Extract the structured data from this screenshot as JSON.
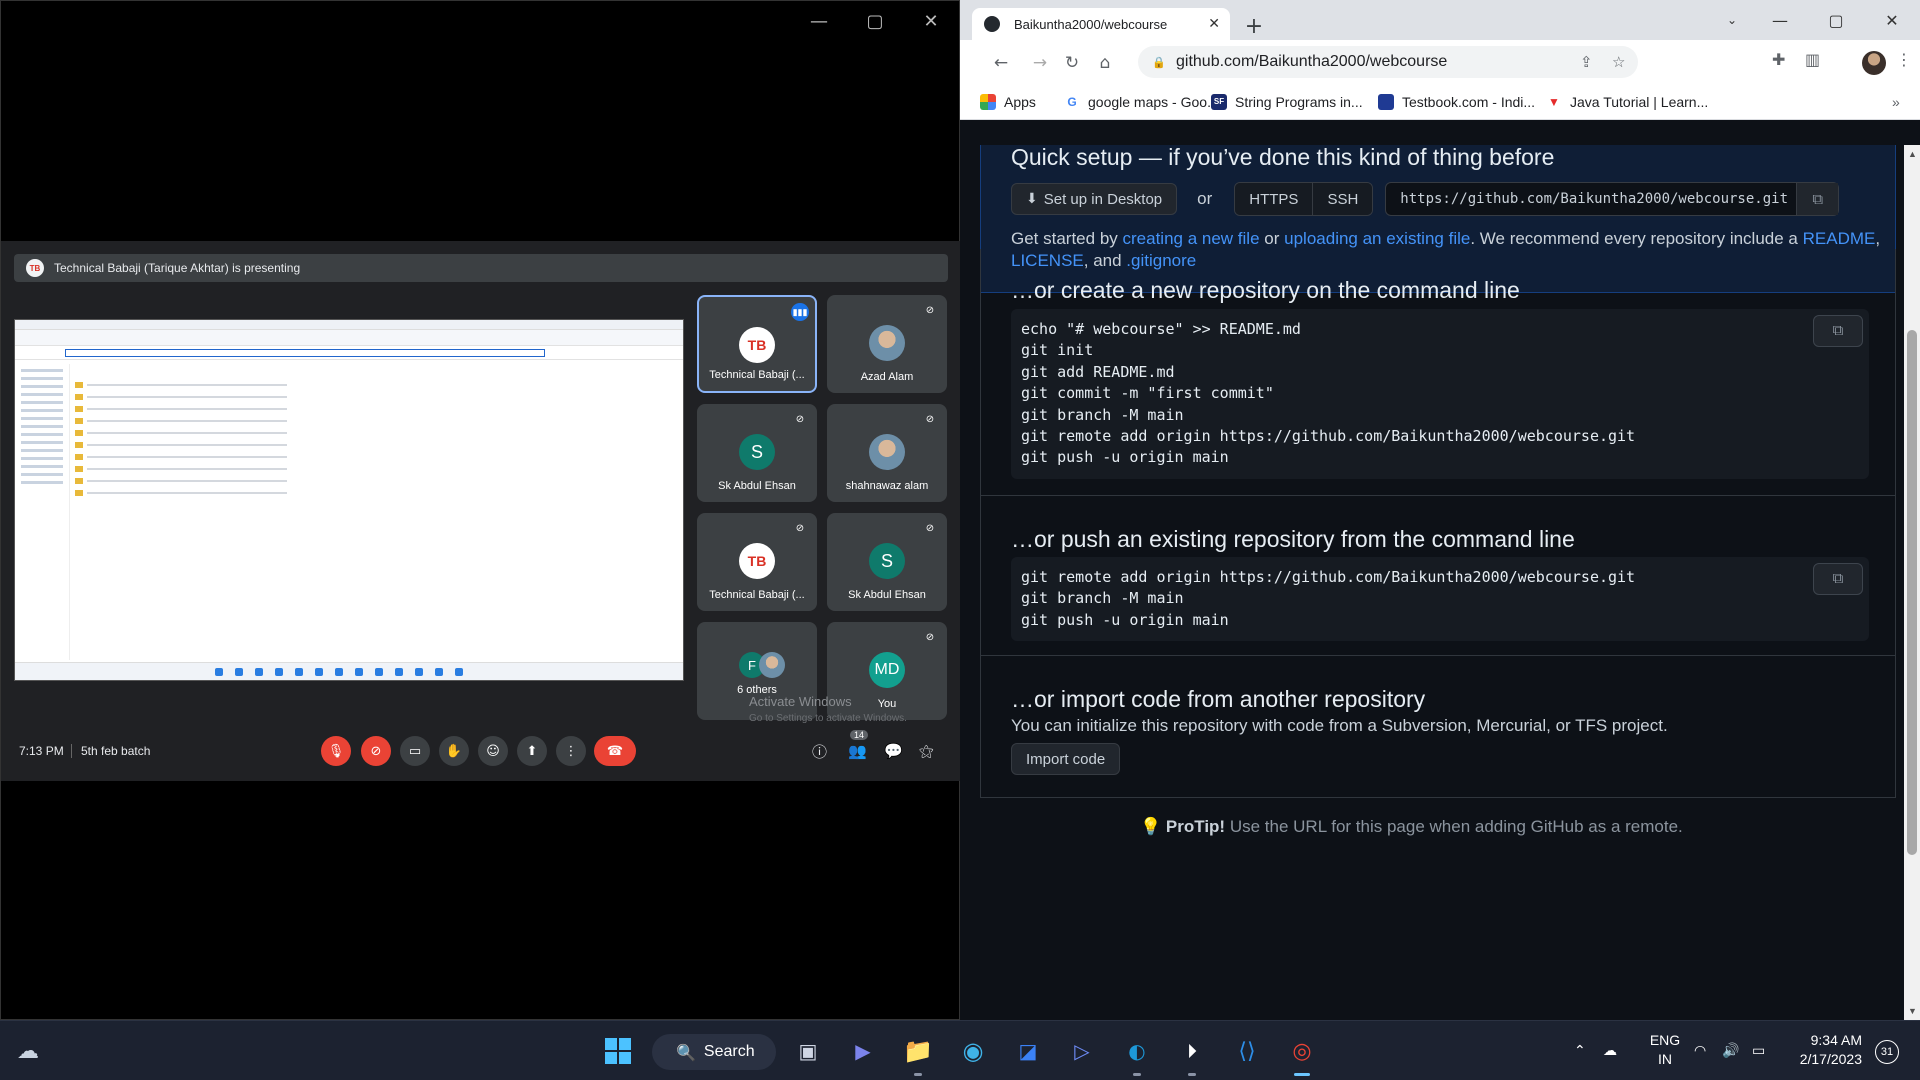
{
  "meet": {
    "window_controls": [
      "—",
      "▢",
      "✕"
    ],
    "presenting_banner": "Technical Babaji (Tarique Akhtar) is presenting",
    "participants": [
      {
        "name": "Technical Babaji (...",
        "avatar": "logo",
        "avatar_text": "TB",
        "status": "speaking",
        "active": true
      },
      {
        "name": "Azad Alam",
        "avatar": "photo",
        "avatar_text": "",
        "status": "muted"
      },
      {
        "name": "Sk Abdul Ehsan",
        "avatar": "letter",
        "avatar_text": "S",
        "status": "muted"
      },
      {
        "name": "shahnawaz alam",
        "avatar": "photo",
        "avatar_text": "",
        "status": "muted"
      },
      {
        "name": "Technical Babaji (...",
        "avatar": "logo",
        "avatar_text": "TB",
        "status": "muted"
      },
      {
        "name": "Sk Abdul Ehsan",
        "avatar": "letter",
        "avatar_text": "S",
        "status": "muted"
      },
      {
        "name": "6 others",
        "avatar": "letter",
        "avatar_text": "F",
        "status": "none"
      },
      {
        "name": "You",
        "avatar": "letter",
        "avatar_text": "MD",
        "status": "muted"
      }
    ],
    "watermark_title": "Activate Windows",
    "watermark_sub": "Go to Settings to activate Windows.",
    "time": "7:13 PM",
    "meeting_name": "5th feb batch",
    "participants_count": "14",
    "controls": [
      "mic-off",
      "camera-off",
      "captions",
      "raise-hand",
      "emoji",
      "present",
      "more",
      "leave"
    ]
  },
  "chrome": {
    "tab_title": "Baikuntha2000/webcourse",
    "url": "github.com/Baikuntha2000/webcourse",
    "bookmarks": [
      {
        "label": "Apps",
        "icon": "apps-grid-icon"
      },
      {
        "label": "google maps - Goo...",
        "icon": "google-icon"
      },
      {
        "label": "String Programs in...",
        "icon": "sf-icon"
      },
      {
        "label": "Testbook.com - Indi...",
        "icon": "testbook-icon"
      },
      {
        "label": "Java Tutorial | Learn...",
        "icon": "javatpoint-icon"
      }
    ],
    "bookmarks_more": "»"
  },
  "github": {
    "quick_setup_title": "Quick setup — if you’ve done this kind of thing before",
    "setup_desktop_label": "Set up in Desktop",
    "or_label": "or",
    "https_label": "HTTPS",
    "ssh_label": "SSH",
    "clone_url": "https://github.com/Baikuntha2000/webcourse.git",
    "desc_prefix": "Get started by",
    "link_new_file": "creating a new file",
    "desc_or": "or",
    "link_upload": "uploading an existing file",
    "desc_mid": ". We recommend every repository include a",
    "link_readme": "README",
    "link_license": "LICENSE",
    "desc_and": ", and",
    "link_gitignore": ".gitignore",
    "create_title": "…or create a new repository on the command line",
    "create_code": [
      "echo \"# webcourse\" >> README.md",
      "git init",
      "git add README.md",
      "git commit -m \"first commit\"",
      "git branch -M main",
      "git remote add origin https://github.com/Baikuntha2000/webcourse.git",
      "git push -u origin main"
    ],
    "push_title": "…or push an existing repository from the command line",
    "push_code": [
      "git remote add origin https://github.com/Baikuntha2000/webcourse.git",
      "git branch -M main",
      "git push -u origin main"
    ],
    "import_title": "…or import code from another repository",
    "import_desc": "You can initialize this repository with code from a Subversion, Mercurial, or TFS project.",
    "import_button": "Import code",
    "protip_label": "ProTip!",
    "protip_text": "Use the URL for this page when adding GitHub as a remote."
  },
  "taskbar": {
    "search_label": "Search",
    "lang_top": "ENG",
    "lang_bottom": "IN",
    "time": "9:34 AM",
    "date": "2/17/2023",
    "notification_count": "31"
  }
}
